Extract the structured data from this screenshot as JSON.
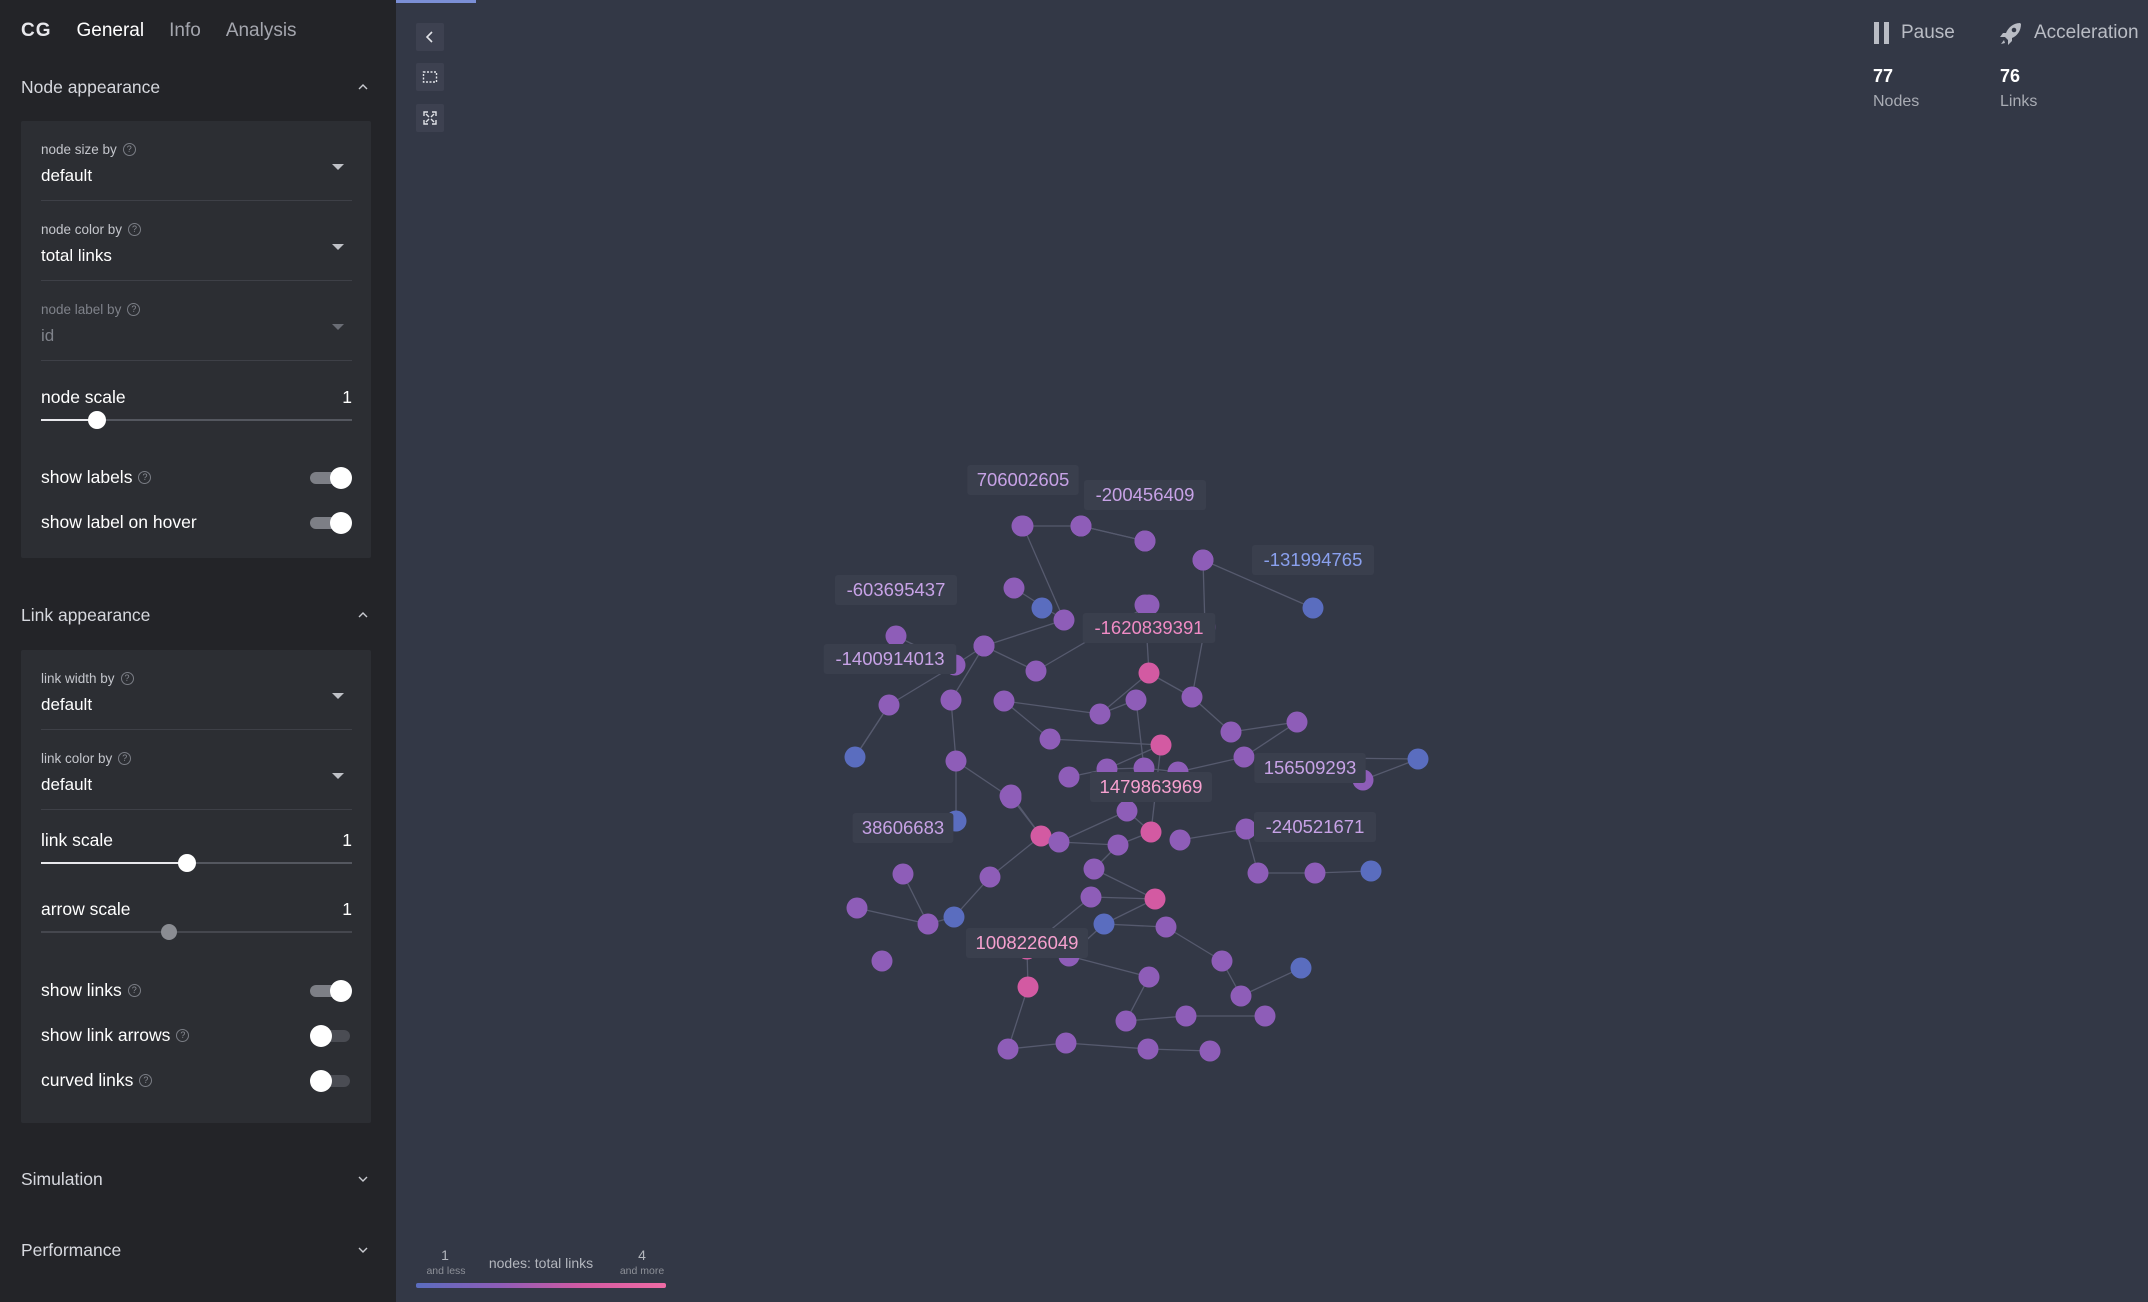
{
  "tabs": [
    "CG",
    "General",
    "Info",
    "Analysis"
  ],
  "node_appearance": {
    "title": "Node appearance",
    "size_by": {
      "label": "node size by",
      "value": "default"
    },
    "color_by": {
      "label": "node color by",
      "value": "total links"
    },
    "label_by": {
      "label": "node label by",
      "value": "id"
    },
    "scale": {
      "label": "node scale",
      "value": "1",
      "fraction": 0.18
    },
    "show_labels": {
      "label": "show labels",
      "on": true
    },
    "show_label_on_hover": {
      "label": "show label on hover",
      "on": true
    }
  },
  "link_appearance": {
    "title": "Link appearance",
    "width_by": {
      "label": "link width by",
      "value": "default"
    },
    "color_by": {
      "label": "link color by",
      "value": "default"
    },
    "link_scale": {
      "label": "link scale",
      "value": "1",
      "fraction": 0.47
    },
    "arrow_scale": {
      "label": "arrow scale",
      "value": "1",
      "fraction": 0.41
    },
    "show_links": {
      "label": "show links",
      "on": true
    },
    "show_link_arrows": {
      "label": "show link arrows",
      "on": false
    },
    "curved_links": {
      "label": "curved links",
      "on": false
    }
  },
  "sections": {
    "simulation": "Simulation",
    "performance": "Performance"
  },
  "controls": {
    "pause": "Pause",
    "acceleration": "Acceleration"
  },
  "stats": {
    "nodes_count": "77",
    "nodes_label": "Nodes",
    "links_count": "76",
    "links_label": "Links"
  },
  "legend": {
    "min": "1",
    "min_note": "and less",
    "title": "nodes: total links",
    "max": "4",
    "max_note": "and more"
  },
  "colors": {
    "background": "#333846",
    "sidebar": "#232428",
    "node_low": "#5a6dbf",
    "node_mid": "#8e5db8",
    "node_high": "#d35aa2"
  },
  "graph": {
    "labels": [
      {
        "text": "706002605",
        "node": 6
      },
      {
        "text": "-200456409",
        "node": 7
      },
      {
        "text": "-131994765",
        "node": 10
      },
      {
        "text": "-603695437",
        "node": 15
      },
      {
        "text": "-1620839391",
        "node": 13
      },
      {
        "text": "-1400914013",
        "node": 17
      },
      {
        "text": "156509293",
        "node": 38
      },
      {
        "text": "1479863969",
        "node": 41
      },
      {
        "text": "38606683",
        "node": 44
      },
      {
        "text": "-240521671",
        "node": 49
      },
      {
        "text": "1008226049",
        "node": 63
      }
    ]
  }
}
